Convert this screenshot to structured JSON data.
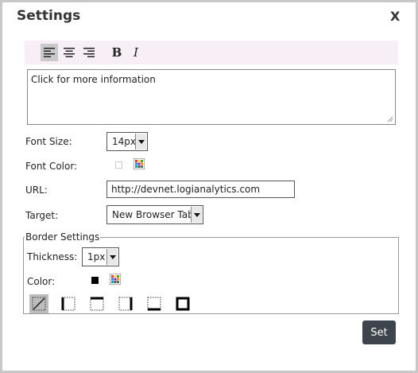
{
  "dialog": {
    "title": "Settings",
    "close_label": "X"
  },
  "toolbar": {
    "buttons": [
      {
        "name": "align-left-icon",
        "active": true
      },
      {
        "name": "align-center-icon",
        "active": false
      },
      {
        "name": "align-right-icon",
        "active": false
      },
      {
        "name": "bold-button",
        "label": "B"
      },
      {
        "name": "italic-button",
        "label": "I"
      }
    ],
    "bold_label": "B",
    "italic_label": "I"
  },
  "editor": {
    "text": "Click for more information"
  },
  "form": {
    "font_size_label": "Font Size:",
    "font_size_value": "14px",
    "font_color_label": "Font Color:",
    "url_label": "URL:",
    "url_value": "http://devnet.logianalytics.com",
    "target_label": "Target:",
    "target_value": "New Browser Tab"
  },
  "border_settings": {
    "legend": "Border Settings",
    "thickness_label": "Thickness:",
    "thickness_value": "1px",
    "color_label": "Color:",
    "color_value": "#000000",
    "options": [
      {
        "name": "border-none-icon",
        "active": true
      },
      {
        "name": "border-left-icon",
        "active": false
      },
      {
        "name": "border-top-icon",
        "active": false
      },
      {
        "name": "border-right-icon",
        "active": false
      },
      {
        "name": "border-bottom-icon",
        "active": false
      },
      {
        "name": "border-all-icon",
        "active": false
      }
    ]
  },
  "actions": {
    "set_label": "Set"
  },
  "colors": {
    "toolbar_bg": "#f7eff5",
    "button_bg": "#3d444b",
    "active_bg": "#c9c9c9"
  }
}
